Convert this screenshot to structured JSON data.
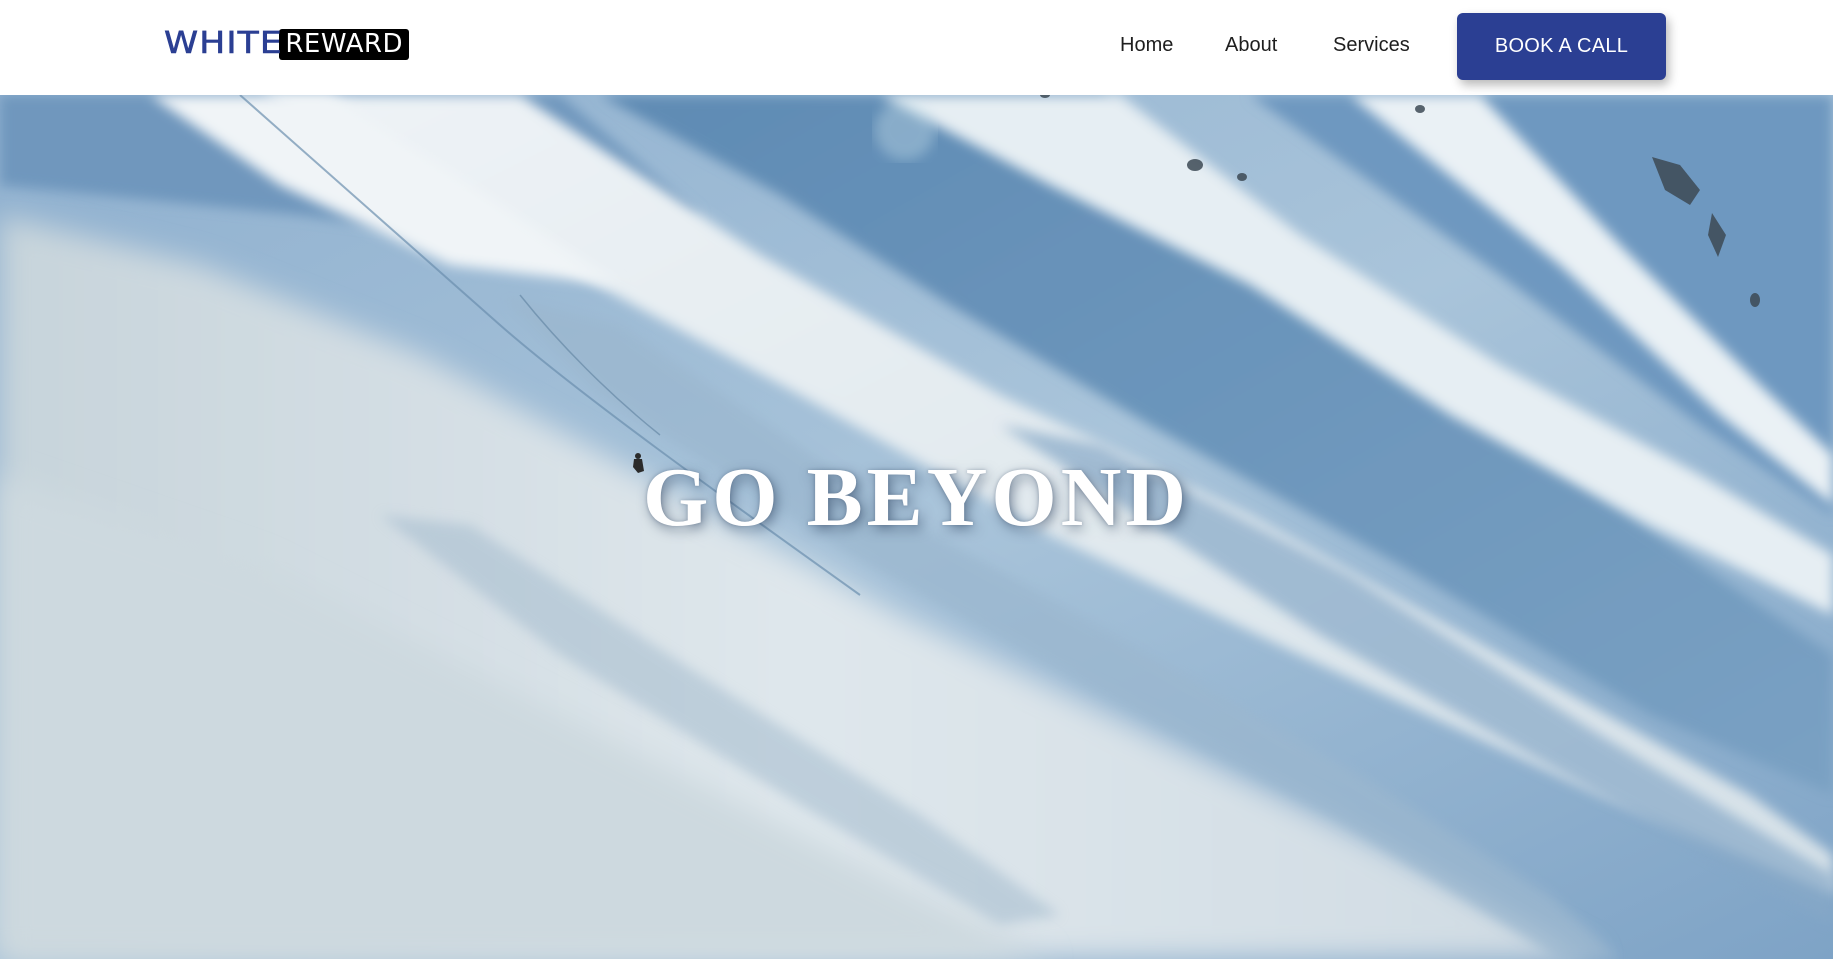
{
  "brand": {
    "logo_part1": "WHITE",
    "logo_part2": "REWARD",
    "primary_color": "#2b3f93"
  },
  "nav": {
    "items": [
      {
        "label": "Home"
      },
      {
        "label": "About"
      },
      {
        "label": "Services"
      }
    ],
    "cta_label": "BOOK A CALL"
  },
  "hero": {
    "title": "GO BEYOND",
    "background": "snowy mountain slope with a skier"
  }
}
